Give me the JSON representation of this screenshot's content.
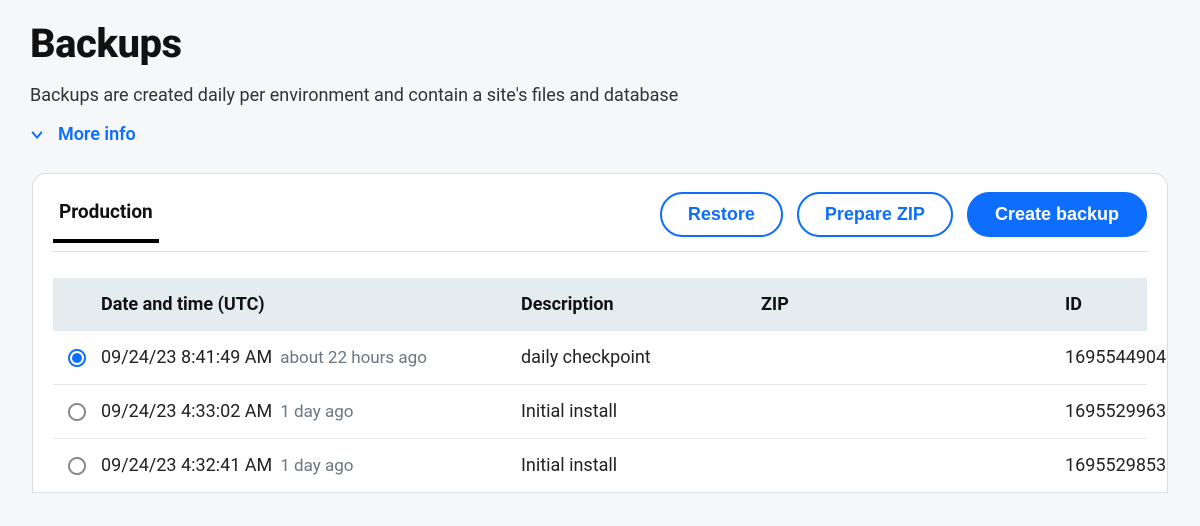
{
  "page": {
    "title": "Backups",
    "subtitle": "Backups are created daily per environment and contain a site's files and database",
    "more_info_label": "More info"
  },
  "tabs": {
    "active": "Production"
  },
  "actions": {
    "restore": "Restore",
    "prepare_zip": "Prepare ZIP",
    "create_backup": "Create backup"
  },
  "table": {
    "headers": {
      "datetime": "Date and time (UTC)",
      "description": "Description",
      "zip": "ZIP",
      "id": "ID"
    },
    "rows": [
      {
        "selected": true,
        "datetime": "09/24/23 8:41:49 AM",
        "ago": "about 22 hours ago",
        "description": "daily checkpoint",
        "zip": "",
        "id": "1695544904"
      },
      {
        "selected": false,
        "datetime": "09/24/23 4:33:02 AM",
        "ago": "1 day ago",
        "description": "Initial install",
        "zip": "",
        "id": "1695529963"
      },
      {
        "selected": false,
        "datetime": "09/24/23 4:32:41 AM",
        "ago": "1 day ago",
        "description": "Initial install",
        "zip": "",
        "id": "1695529853"
      }
    ]
  }
}
